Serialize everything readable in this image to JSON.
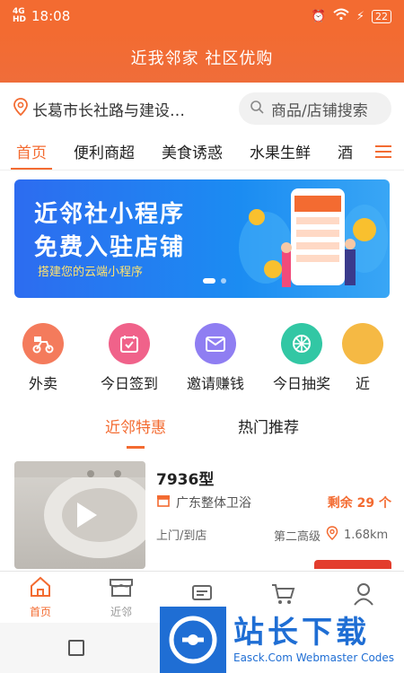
{
  "status": {
    "network": "4G\nHD",
    "time": "18:08",
    "battery": "22"
  },
  "header": {
    "title": "近我邻家 社区优购"
  },
  "location": {
    "text": "长葛市长社路与建设…"
  },
  "search": {
    "placeholder": "商品/店铺搜索"
  },
  "tabs": [
    "首页",
    "便利商超",
    "美食诱惑",
    "水果生鲜",
    "酒"
  ],
  "banner": {
    "line1": "近邻社小程序",
    "line2": "免费入驻店铺",
    "line3": "搭建您的云端小程序"
  },
  "quick_icons": [
    {
      "label": "外卖",
      "color": "#f47b5c"
    },
    {
      "label": "今日签到",
      "color": "#f0628a"
    },
    {
      "label": "邀请赚钱",
      "color": "#8f7ef2"
    },
    {
      "label": "今日抽奖",
      "color": "#32c7a4"
    },
    {
      "label": "近",
      "color": "#f5b944"
    }
  ],
  "sub_tabs": [
    "近邻特惠",
    "热门推荐"
  ],
  "product": {
    "name": "7936型",
    "shop": "广东整体卫浴",
    "remaining": "剩余 29 个",
    "delivery": "上门/到店",
    "level": "第二高级",
    "distance": "1.68km"
  },
  "bottom_nav": [
    "首页",
    "近邻",
    "",
    "",
    ""
  ],
  "watermark": {
    "big": "站长下载",
    "small": "Easck.Com Webmaster Codes"
  }
}
